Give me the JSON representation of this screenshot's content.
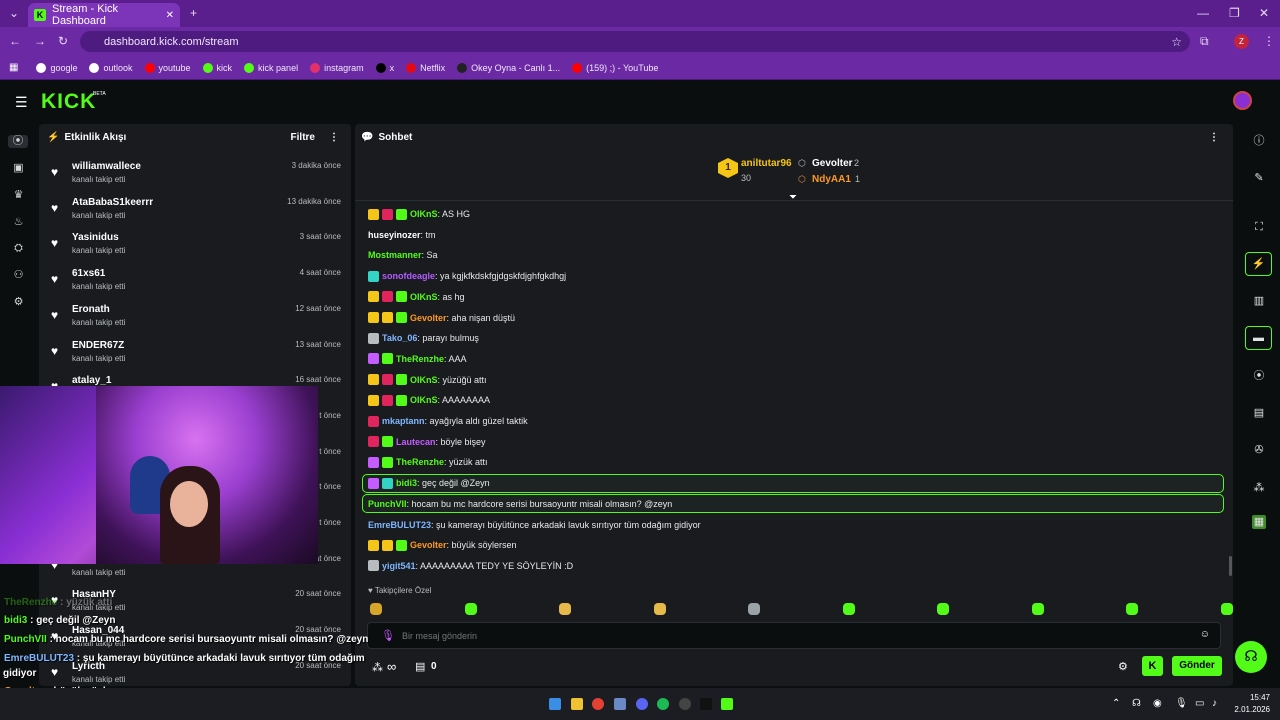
{
  "browser": {
    "tab_title": "Stream - Kick Dashboard",
    "url": "dashboard.kick.com/stream",
    "profile_initial": "Z",
    "bookmarks": [
      {
        "label": "google",
        "color": "#ffffff"
      },
      {
        "label": "outlook",
        "color": "#ffffff"
      },
      {
        "label": "youtube",
        "color": "#ff0000"
      },
      {
        "label": "kick",
        "color": "#53fc18"
      },
      {
        "label": "kick panel",
        "color": "#53fc18"
      },
      {
        "label": "instagram",
        "color": "#e1306c"
      },
      {
        "label": "x",
        "color": "#000000"
      },
      {
        "label": "Netflix",
        "color": "#e50914"
      },
      {
        "label": "Okey Oyna - Canlı 1...",
        "color": "#222222"
      },
      {
        "label": "(159) ;) - YouTube",
        "color": "#ff0000"
      }
    ]
  },
  "site": {
    "logo": "KICK",
    "beta": "BETA"
  },
  "activity": {
    "title": "Etkinlik Akışı",
    "filter_label": "Filtre",
    "items": [
      {
        "name": "williamwallece",
        "sub": "kanalı takip etti",
        "time": "3 dakika önce"
      },
      {
        "name": "AtaBabaS1keerrr",
        "sub": "kanalı takip etti",
        "time": "13 dakika önce"
      },
      {
        "name": "Yasinidus",
        "sub": "kanalı takip etti",
        "time": "3 saat önce"
      },
      {
        "name": "61xs61",
        "sub": "kanalı takip etti",
        "time": "4 saat önce"
      },
      {
        "name": "Eronath",
        "sub": "kanalı takip etti",
        "time": "12 saat önce"
      },
      {
        "name": "ENDER67Z",
        "sub": "kanalı takip etti",
        "time": "13 saat önce"
      },
      {
        "name": "atalay_1",
        "sub": "kanalı takip etti",
        "time": "16 saat önce"
      },
      {
        "name": "",
        "sub": "",
        "time": "t önce"
      },
      {
        "name": "",
        "sub": "",
        "time": "t önce"
      },
      {
        "name": "",
        "sub": "",
        "time": "t önce"
      },
      {
        "name": "",
        "sub": "",
        "time": "t önce"
      },
      {
        "name": "",
        "sub": "kanalı takip etti",
        "time": "20 saat önce"
      },
      {
        "name": "HasanHY",
        "sub": "kanalı takip etti",
        "time": "20 saat önce"
      },
      {
        "name": "Hasan_044",
        "sub": "kanalı takip etti",
        "time": "20 saat önce"
      },
      {
        "name": "Lyricth",
        "sub": "kanalı takip etti",
        "time": "20 saat önce"
      }
    ]
  },
  "chat": {
    "title": "Sohbet",
    "leaderboard": {
      "top_name": "aniltutar96",
      "top_count": "30",
      "top_rank": "1",
      "second_name": "Gevolter",
      "second_count": "2",
      "third_name": "NdyAA1",
      "third_count": "1"
    },
    "messages": [
      {
        "user": "OIKnS",
        "color": "#53fc18",
        "text": ": AS HG",
        "badges": [
          "#f5c518",
          "#e0245e",
          "#53fc18"
        ]
      },
      {
        "user": "huseyinozer",
        "color": "#ffffff",
        "text": ": tm",
        "badges": []
      },
      {
        "user": "Mostmanner",
        "color": "#53fc18",
        "text": ": Sa",
        "badges": []
      },
      {
        "user": "sonofdeagle",
        "color": "#b35cff",
        "text": ": ya kgjkfkdskfgjdgskfdjghfgkdhgj",
        "badges": [
          "#33d3c6"
        ]
      },
      {
        "user": "OIKnS",
        "color": "#53fc18",
        "text": ": as hg",
        "badges": [
          "#f5c518",
          "#e0245e",
          "#53fc18"
        ]
      },
      {
        "user": "Gevolter",
        "color": "#ff9a1f",
        "text": ": aha nişan düştü",
        "badges": [
          "#f5c518",
          "#f5c518",
          "#53fc18"
        ]
      },
      {
        "user": "Tako_06",
        "color": "#7fb7ff",
        "text": ": parayı bulmuş",
        "badges": [
          "#b9bcbf"
        ]
      },
      {
        "user": "TheRenzhe",
        "color": "#53fc18",
        "text": ": AAA",
        "badges": [
          "#c45cff",
          "#53fc18"
        ]
      },
      {
        "user": "OIKnS",
        "color": "#53fc18",
        "text": ": yüzüğü attı",
        "badges": [
          "#f5c518",
          "#e0245e",
          "#53fc18"
        ]
      },
      {
        "user": "OIKnS",
        "color": "#53fc18",
        "text": ": AAAAAAAA",
        "badges": [
          "#f5c518",
          "#e0245e",
          "#53fc18"
        ]
      },
      {
        "user": "mkaptann",
        "color": "#7fb7ff",
        "text": ": ayağıyla aldı güzel taktik",
        "badges": [
          "#e0245e"
        ]
      },
      {
        "user": "Lautecan",
        "color": "#c45cff",
        "text": ": böyle bişey",
        "badges": [
          "#e0245e",
          "#53fc18"
        ]
      },
      {
        "user": "TheRenzhe",
        "color": "#53fc18",
        "text": ": yüzük attı",
        "badges": [
          "#c45cff",
          "#53fc18"
        ]
      },
      {
        "user": "bidi3",
        "color": "#53fc18",
        "text": ": geç değil @Zeyn",
        "badges": [
          "#c45cff",
          "#33d3c6"
        ],
        "highlight": true
      },
      {
        "user": "PunchVII",
        "color": "#53fc18",
        "text": ": hocam bu mc hardcore serisi bursaoyuntr misali olmasın? @zeyn",
        "badges": [],
        "highlight": true
      },
      {
        "user": "EmreBULUT23",
        "color": "#7fb7ff",
        "text": ": şu kamerayı büyütünce arkadaki lavuk sırıtıyor tüm odağım gidiyor",
        "badges": []
      },
      {
        "user": "Gevolter",
        "color": "#ff9a1f",
        "text": ": büyük söylersen",
        "badges": [
          "#f5c518",
          "#f5c518",
          "#53fc18"
        ]
      },
      {
        "user": "yigit541",
        "color": "#7fb7ff",
        "text": ": AAAAAAAAA TEDY YE SÖYLEYİN :D",
        "badges": [
          "#b9bcbf"
        ]
      }
    ],
    "followers_only_label": "Takipçilere Özel",
    "input_placeholder": "Bir mesaj gönderin",
    "points_symbol": "∞",
    "store_count": "0",
    "send_label": "Gönder"
  },
  "overlay_chat": [
    {
      "user": "TheRenzhe",
      "text": " : yüzük atti",
      "color": "#53fc18"
    },
    {
      "user": "bidi3",
      "text": " : geç değil @Zeyn",
      "color": "#53fc18"
    },
    {
      "user": "PunchVII",
      "text": " : hocam bu mc hardcore serisi bursaoyuntr misali olmasın? @zeyn",
      "color": "#53fc18"
    },
    {
      "user": "EmreBULUT23",
      "text": " : şu kamerayı büyütünce arkadaki lavuk sırıtıyor tüm odağım",
      "color": "#7fb7ff"
    },
    {
      "user": "",
      "text": "gidiyor",
      "color": "#ffffff"
    },
    {
      "user": "Gevolter",
      "text": " : büyük söylersen",
      "color": "#ff9a1f"
    },
    {
      "user": "yigit541",
      "text": " : AAAAAAAAA TEDY YE SÖYLEYİN :D",
      "color": "#7fb7ff"
    }
  ],
  "taskbar": {
    "time": "15:47",
    "date": "2.01.2026"
  }
}
